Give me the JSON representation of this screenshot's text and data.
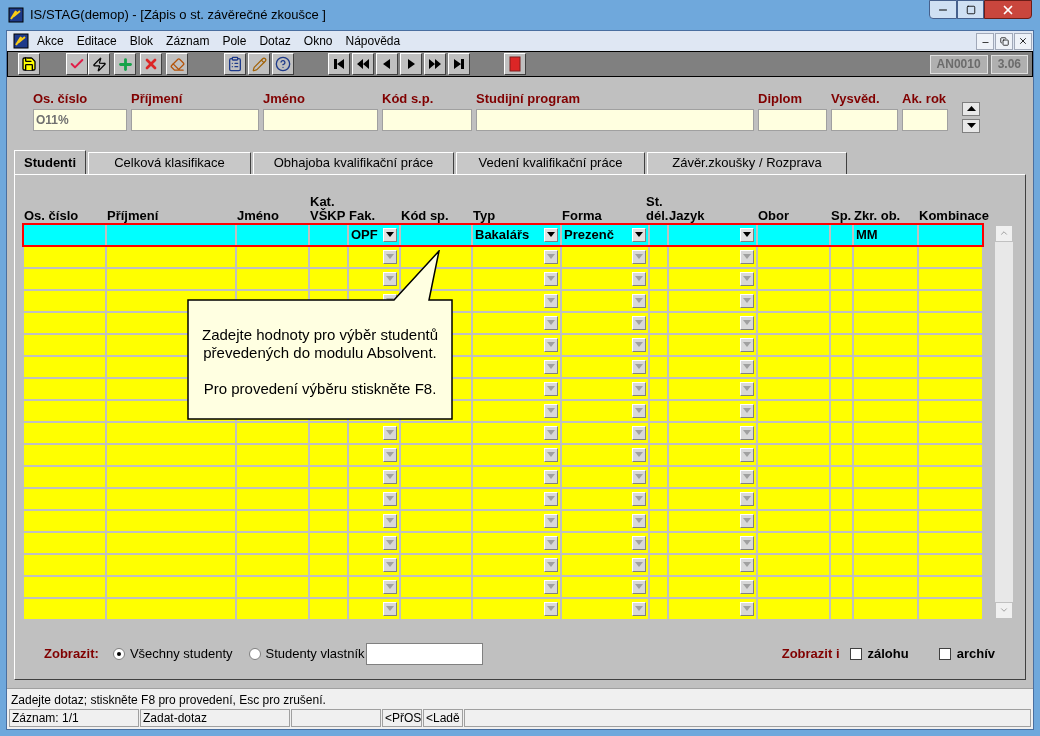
{
  "window": {
    "title": "IS/STAG(demop) - [Zápis o st. závěrečné zkoušce ]"
  },
  "menu": [
    "Akce",
    "Editace",
    "Blok",
    "Záznam",
    "Pole",
    "Dotaz",
    "Okno",
    "Nápověda"
  ],
  "toolbar_badges": [
    "AN0010",
    "3.06"
  ],
  "header_fields": [
    {
      "label": "Os. číslo",
      "value": "O11%"
    },
    {
      "label": "Příjmení"
    },
    {
      "label": "Jméno"
    },
    {
      "label": "Kód s.p."
    },
    {
      "label": "Studijní program"
    },
    {
      "label": "Diplom"
    },
    {
      "label": "Vysvěd."
    },
    {
      "label": "Ak. rok"
    }
  ],
  "tabs": [
    {
      "label": "Studenti",
      "selected": true
    },
    {
      "label": "Celková klasifikace",
      "selected": false
    },
    {
      "label": "Obhajoba kvalifikační práce",
      "selected": false
    },
    {
      "label": "Vedení kvalifikační práce",
      "selected": false
    },
    {
      "label": "Závěr.zkoušky / Rozprava",
      "selected": false
    }
  ],
  "grid": {
    "columns": [
      {
        "header": [
          "Os. číslo"
        ],
        "kind": "text"
      },
      {
        "header": [
          "Příjmení"
        ],
        "kind": "text"
      },
      {
        "header": [
          "Jméno"
        ],
        "kind": "text"
      },
      {
        "header": [
          "Kat.",
          "VŠKP"
        ],
        "kind": "text"
      },
      {
        "header": [
          "Fak."
        ],
        "kind": "dropdown",
        "query_value": "OPF"
      },
      {
        "header": [
          "Kód sp."
        ],
        "kind": "text"
      },
      {
        "header": [
          "Typ"
        ],
        "kind": "dropdown",
        "query_value": "Bakalářs"
      },
      {
        "header": [
          "Forma"
        ],
        "kind": "dropdown",
        "query_value": "Prezenč"
      },
      {
        "header": [
          "St.",
          "dél."
        ],
        "kind": "text"
      },
      {
        "header": [
          "Jazyk"
        ],
        "kind": "dropdown"
      },
      {
        "header": [
          "Obor"
        ],
        "kind": "text"
      },
      {
        "header": [
          "Sp."
        ],
        "kind": "text"
      },
      {
        "header": [
          "Zkr. ob."
        ],
        "kind": "text",
        "query_value": "MM"
      },
      {
        "header": [
          "Kombinace"
        ],
        "kind": "text"
      }
    ],
    "tooltip": [
      "Zadejte hodnoty pro výběr studentů převedených do modulu Absolvent.",
      "Pro provedení výběru stiskněte F8."
    ]
  },
  "filter": {
    "label": "Zobrazit:",
    "options": [
      {
        "label": "Všechny studenty",
        "selected": true
      },
      {
        "label": "Studenty vlastník",
        "selected": false
      }
    ]
  },
  "show_also": {
    "label": "Zobrazit i",
    "options": [
      {
        "label": "zálohu",
        "checked": false
      },
      {
        "label": "archív",
        "checked": false
      }
    ]
  },
  "status_bar": {
    "message": "Zadejte dotaz; stiskněte F8 pro provedení, Esc  pro zrušení.",
    "cells": [
      "Záznam: 1/1",
      "Zadat-dotaz",
      "",
      "<PřOS",
      "<Ladě",
      ""
    ]
  }
}
